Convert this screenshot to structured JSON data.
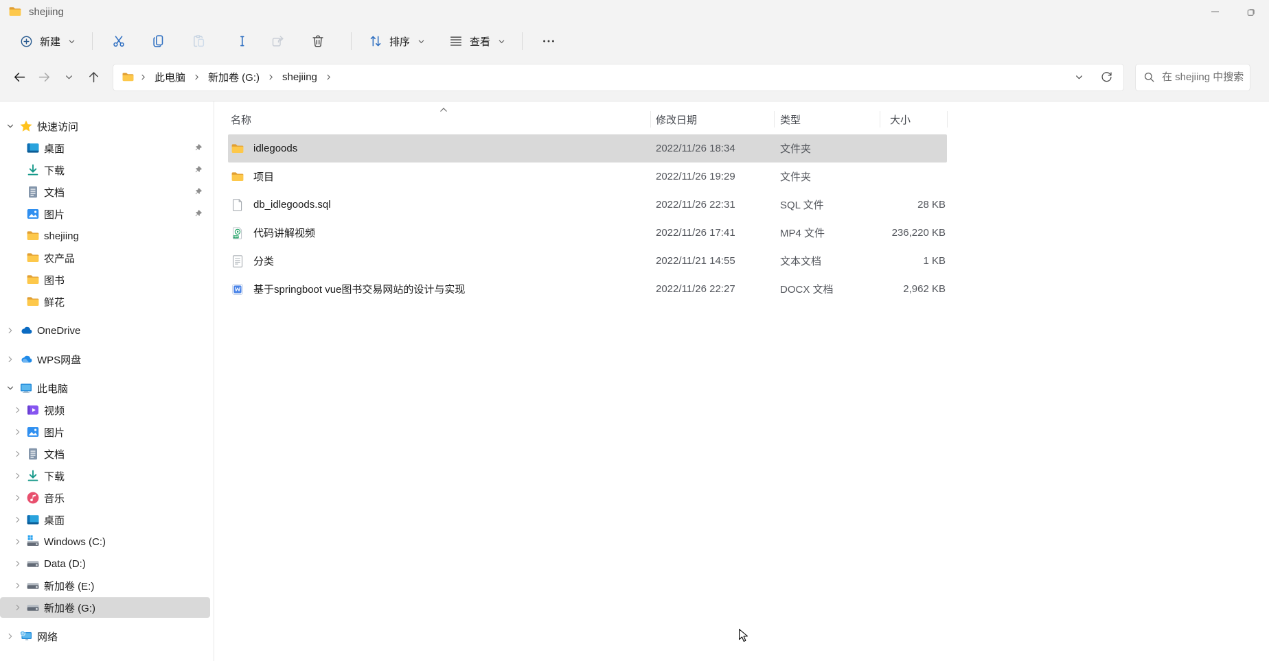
{
  "titlebar": {
    "title": "shejiing"
  },
  "toolbar": {
    "new_label": "新建",
    "sort_label": "排序",
    "view_label": "查看"
  },
  "address": {
    "breadcrumb_items": [
      "此电脑",
      "新加卷 (G:)",
      "shejiing"
    ],
    "search_placeholder": "在 shejiing 中搜索"
  },
  "sidebar": {
    "items": [
      {
        "label": "快速访问",
        "icon": "star",
        "depth": 0,
        "expander": "open"
      },
      {
        "label": "桌面",
        "icon": "desktop",
        "depth": 1,
        "pinned": true
      },
      {
        "label": "下载",
        "icon": "download",
        "depth": 1,
        "pinned": true
      },
      {
        "label": "文档",
        "icon": "document",
        "depth": 1,
        "pinned": true
      },
      {
        "label": "图片",
        "icon": "pictures",
        "depth": 1,
        "pinned": true
      },
      {
        "label": "shejiing",
        "icon": "folder",
        "depth": 1
      },
      {
        "label": "农产品",
        "icon": "folder",
        "depth": 1
      },
      {
        "label": "图书",
        "icon": "folder",
        "depth": 1
      },
      {
        "label": "鲜花",
        "icon": "folder",
        "depth": 1
      },
      {
        "label": "OneDrive",
        "icon": "onedrive",
        "depth": 0,
        "expander": "closed",
        "gap_before": true
      },
      {
        "label": "WPS网盘",
        "icon": "wps",
        "depth": 0,
        "expander": "closed",
        "gap_before": true
      },
      {
        "label": "此电脑",
        "icon": "computer",
        "depth": 0,
        "expander": "open",
        "gap_before": true
      },
      {
        "label": "视频",
        "icon": "video",
        "depth": 1,
        "expander": "closed"
      },
      {
        "label": "图片",
        "icon": "pictures",
        "depth": 1,
        "expander": "closed"
      },
      {
        "label": "文档",
        "icon": "document",
        "depth": 1,
        "expander": "closed"
      },
      {
        "label": "下载",
        "icon": "download",
        "depth": 1,
        "expander": "closed"
      },
      {
        "label": "音乐",
        "icon": "music",
        "depth": 1,
        "expander": "closed"
      },
      {
        "label": "桌面",
        "icon": "desktop",
        "depth": 1,
        "expander": "closed"
      },
      {
        "label": "Windows (C:)",
        "icon": "driveos",
        "depth": 1,
        "expander": "closed"
      },
      {
        "label": "Data (D:)",
        "icon": "drive",
        "depth": 1,
        "expander": "closed"
      },
      {
        "label": "新加卷 (E:)",
        "icon": "drive",
        "depth": 1,
        "expander": "closed"
      },
      {
        "label": "新加卷 (G:)",
        "icon": "drive",
        "depth": 1,
        "expander": "closed",
        "selected": true
      },
      {
        "label": "网络",
        "icon": "network",
        "depth": 0,
        "expander": "closed",
        "gap_before": true
      }
    ]
  },
  "files": {
    "columns": {
      "name": "名称",
      "date": "修改日期",
      "type": "类型",
      "size": "大小"
    },
    "rows": [
      {
        "icon": "folder",
        "name": "idlegoods",
        "date": "2022/11/26 18:34",
        "type": "文件夹",
        "size": "",
        "selected": true
      },
      {
        "icon": "folder",
        "name": "项目",
        "date": "2022/11/26 19:29",
        "type": "文件夹",
        "size": ""
      },
      {
        "icon": "sql",
        "name": "db_idlegoods.sql",
        "date": "2022/11/26 22:31",
        "type": "SQL 文件",
        "size": "28 KB"
      },
      {
        "icon": "mp4",
        "name": "代码讲解视频",
        "date": "2022/11/26 17:41",
        "type": "MP4 文件",
        "size": "236,220 KB"
      },
      {
        "icon": "txt",
        "name": "分类",
        "date": "2022/11/21 14:55",
        "type": "文本文档",
        "size": "1 KB"
      },
      {
        "icon": "docx",
        "name": "基于springboot vue图书交易网站的设计与实现",
        "date": "2022/11/26 22:27",
        "type": "DOCX 文档",
        "size": "2,962 KB"
      }
    ]
  },
  "colors": {
    "chrome_bg": "#f3f3f3",
    "accent_blue": "#2f6fc1",
    "selection_gray": "#d9d9d9",
    "folder_yellow": "#fdc84b"
  }
}
